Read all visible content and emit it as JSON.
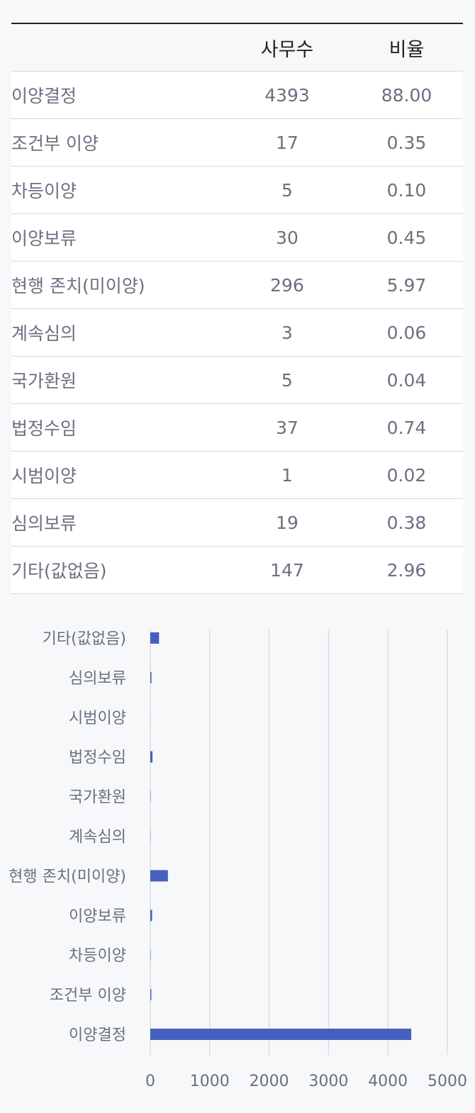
{
  "table": {
    "headers": [
      "",
      "사무수",
      "비율"
    ],
    "rows": [
      {
        "label": "이양결정",
        "count": "4393",
        "ratio": "88.00"
      },
      {
        "label": "조건부 이양",
        "count": "17",
        "ratio": "0.35"
      },
      {
        "label": "차등이양",
        "count": "5",
        "ratio": "0.10"
      },
      {
        "label": "이양보류",
        "count": "30",
        "ratio": "0.45"
      },
      {
        "label": "현행 존치(미이양)",
        "count": "296",
        "ratio": "5.97"
      },
      {
        "label": "계속심의",
        "count": "3",
        "ratio": "0.06"
      },
      {
        "label": "국가환원",
        "count": "5",
        "ratio": "0.04"
      },
      {
        "label": "법정수임",
        "count": "37",
        "ratio": "0.74"
      },
      {
        "label": "시범이양",
        "count": "1",
        "ratio": "0.02"
      },
      {
        "label": "심의보류",
        "count": "19",
        "ratio": "0.38"
      },
      {
        "label": "기타(값없음)",
        "count": "147",
        "ratio": "2.96"
      }
    ]
  },
  "chart_data": {
    "type": "bar",
    "orientation": "horizontal",
    "categories": [
      "이양결정",
      "조건부 이양",
      "차등이양",
      "이양보류",
      "현행 존치(미이양)",
      "계속심의",
      "국가환원",
      "법정수임",
      "시범이양",
      "심의보류",
      "기타(값없음)"
    ],
    "values": [
      4393,
      17,
      5,
      30,
      296,
      3,
      5,
      37,
      1,
      19,
      147
    ],
    "xlim": [
      0,
      5000
    ],
    "xticks": [
      0,
      1000,
      2000,
      3000,
      4000,
      5000
    ],
    "grid": true,
    "bar_color": "#4560bd",
    "grid_color": "#dcdde2"
  }
}
